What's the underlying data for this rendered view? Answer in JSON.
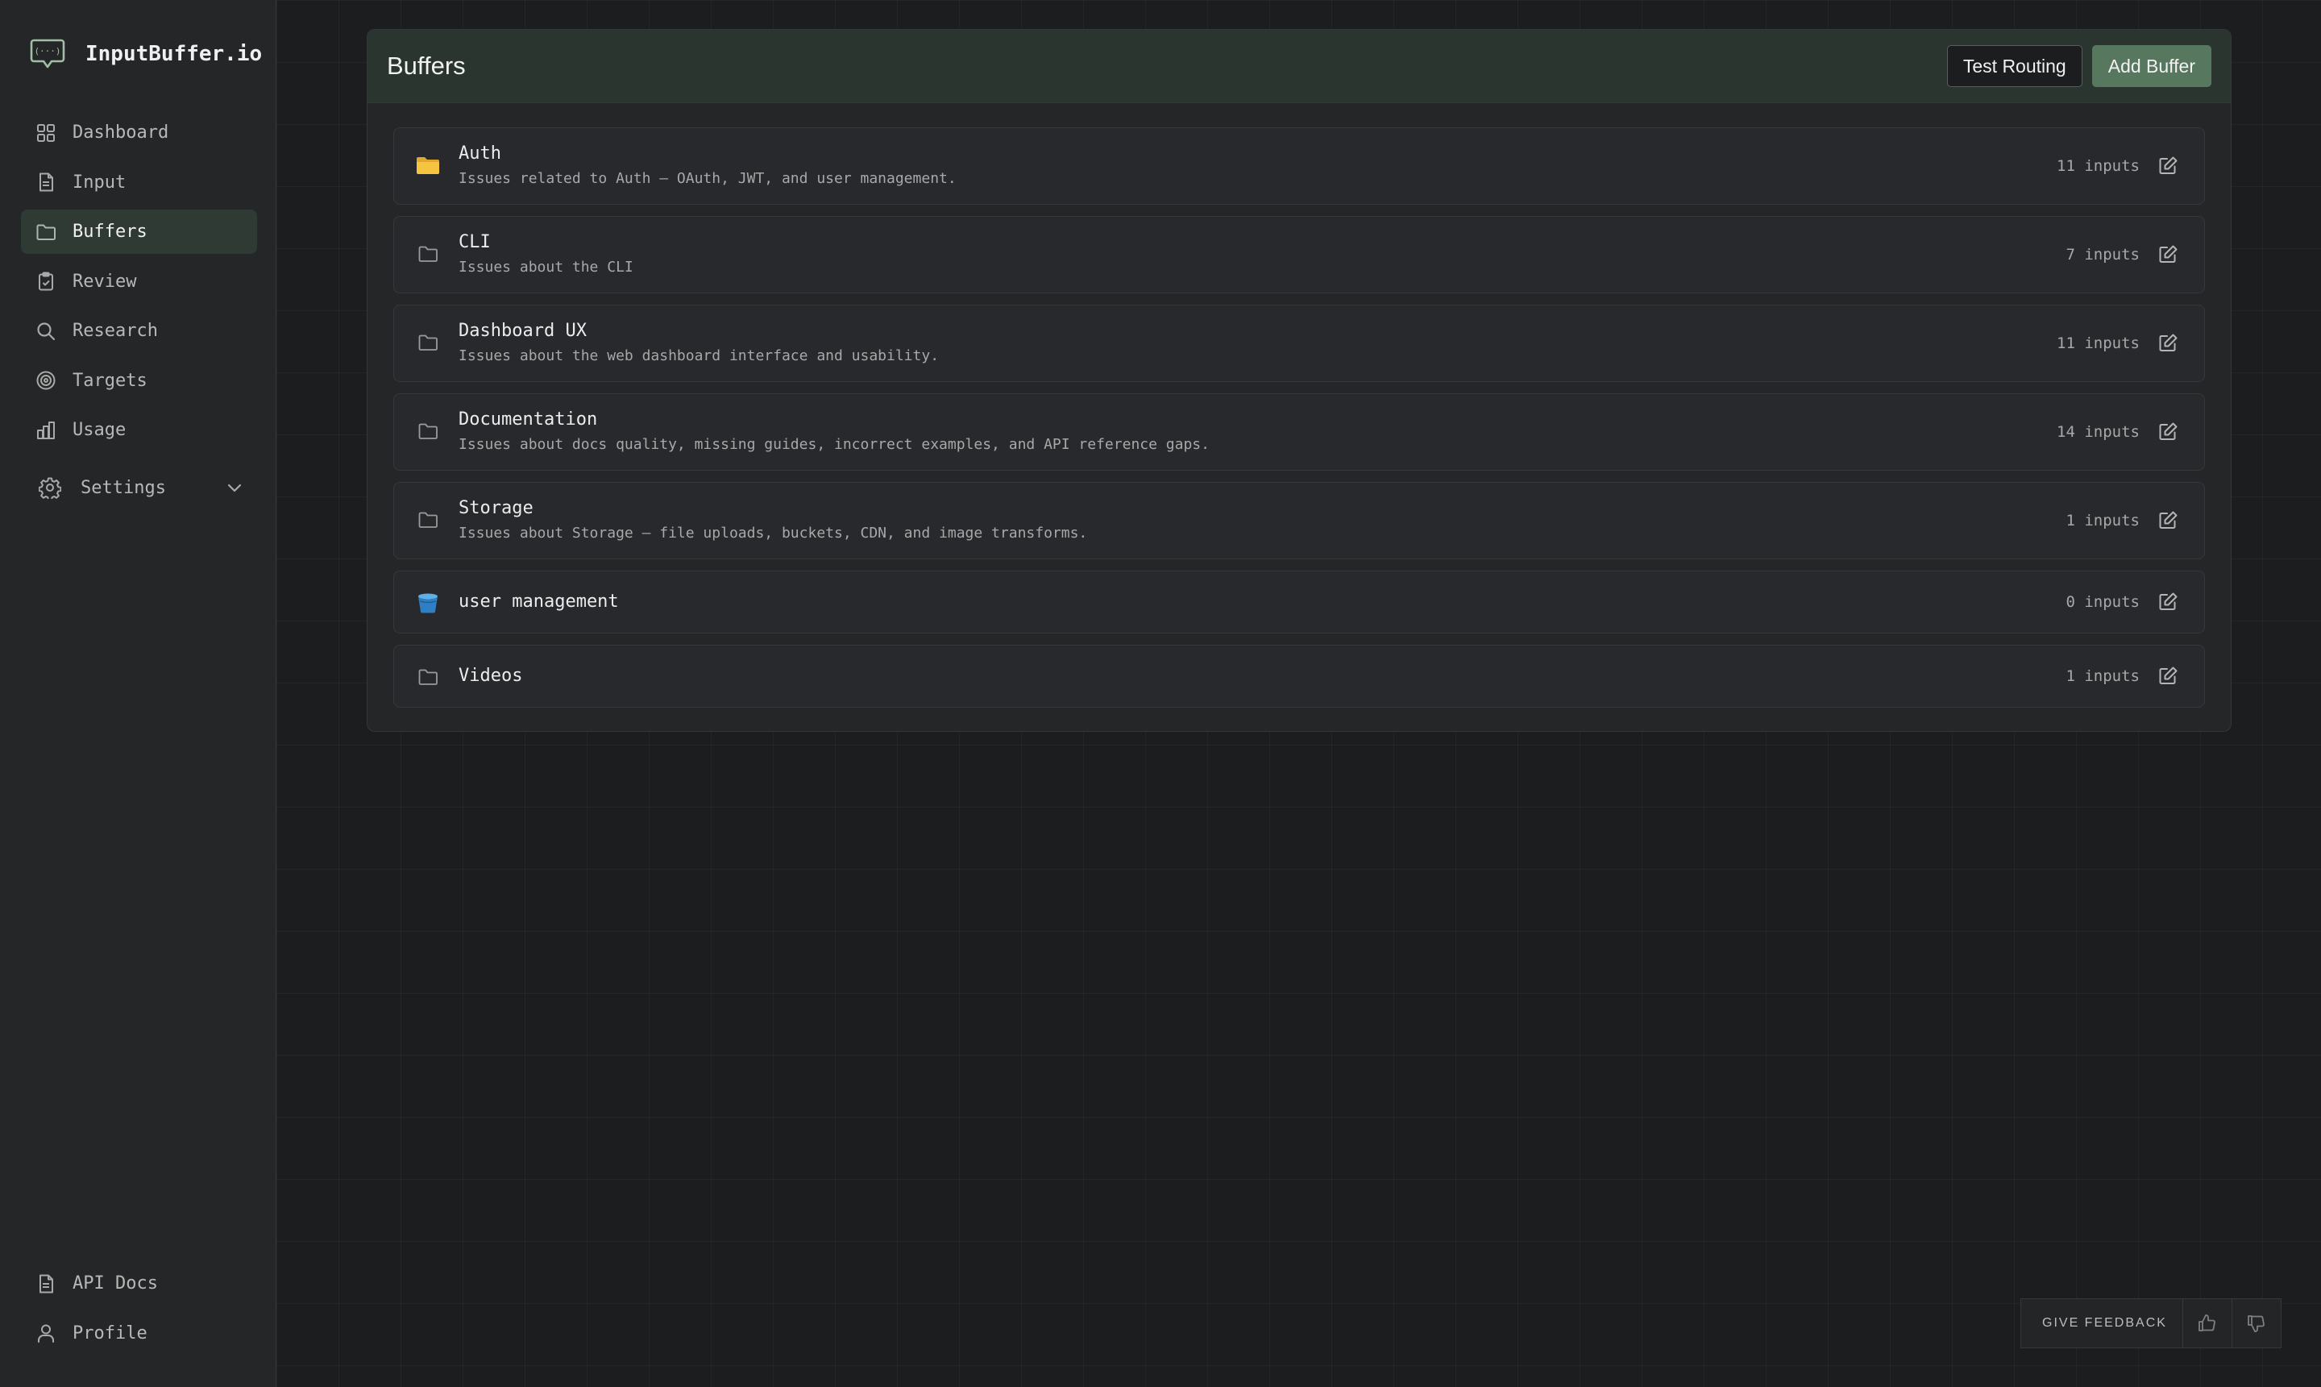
{
  "app": {
    "brand_name": "InputBuffer.io"
  },
  "sidebar": {
    "items": [
      {
        "label": "Dashboard",
        "icon": "grid-icon"
      },
      {
        "label": "Input",
        "icon": "document-icon"
      },
      {
        "label": "Buffers",
        "icon": "folder-icon",
        "active": true
      },
      {
        "label": "Review",
        "icon": "clipboard-icon"
      },
      {
        "label": "Research",
        "icon": "search-icon"
      },
      {
        "label": "Targets",
        "icon": "target-icon"
      },
      {
        "label": "Usage",
        "icon": "bar-chart-icon"
      }
    ],
    "settings_label": "Settings",
    "bottom_items": [
      {
        "label": "API Docs",
        "icon": "document-icon"
      },
      {
        "label": "Profile",
        "icon": "user-icon"
      }
    ]
  },
  "panel": {
    "title": "Buffers",
    "test_routing_label": "Test Routing",
    "add_buffer_label": "Add Buffer"
  },
  "buffers": [
    {
      "name": "Auth",
      "description": "Issues related to Auth — OAuth, JWT, and user management.",
      "count": "11 inputs",
      "icon": "yellow-folder-emoji-icon"
    },
    {
      "name": "CLI",
      "description": "Issues about the CLI",
      "count": "7 inputs",
      "icon": "folder-icon"
    },
    {
      "name": "Dashboard UX",
      "description": "Issues about the web dashboard interface and usability.",
      "count": "11 inputs",
      "icon": "folder-icon"
    },
    {
      "name": "Documentation",
      "description": "Issues about docs quality, missing guides, incorrect examples, and API reference gaps.",
      "count": "14 inputs",
      "icon": "folder-icon"
    },
    {
      "name": "Storage",
      "description": "Issues about Storage — file uploads, buckets, CDN, and image transforms.",
      "count": "1 inputs",
      "icon": "folder-icon"
    },
    {
      "name": "user management",
      "description": "",
      "count": "0 inputs",
      "icon": "bucket-emoji-icon"
    },
    {
      "name": "Videos",
      "description": "",
      "count": "1 inputs",
      "icon": "folder-icon"
    }
  ],
  "feedback": {
    "label": "GIVE FEEDBACK"
  },
  "colors": {
    "accent": "#57775f",
    "active_nav_bg": "#2e3a33",
    "panel_header_bg": "#2b3530"
  }
}
